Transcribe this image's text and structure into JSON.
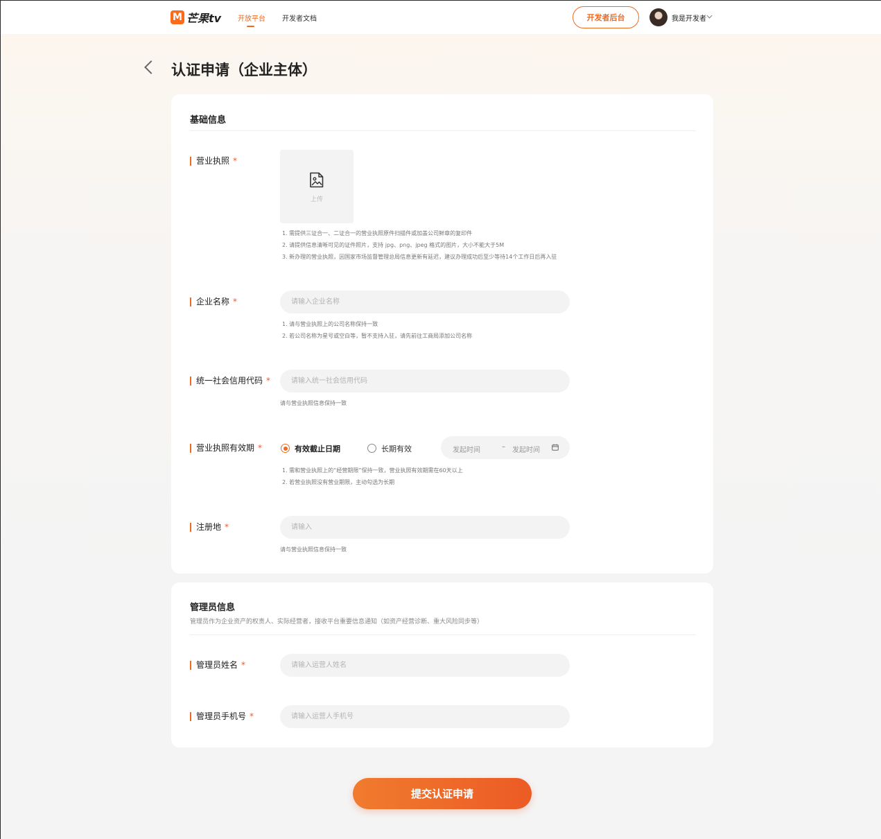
{
  "header": {
    "logo_mark": "M",
    "logo_text": "芒果tv",
    "nav": [
      {
        "label": "开放平台",
        "active": true
      },
      {
        "label": "开发者文档",
        "active": false
      }
    ],
    "dev_button": "开发者后台",
    "user_name": "我是开发者"
  },
  "page": {
    "title": "认证申请（企业主体）"
  },
  "basic": {
    "title": "基础信息",
    "license": {
      "label": "营业执照",
      "required": "*",
      "upload_label": "上传",
      "hints": [
        "1. 需提供三证合一、二证合一的营业执照原件扫描件或加盖公司鲜章的复印件",
        "2. 请提供信息清晰可见的证件照片，支持 jpg、png、jpeg 格式的图片，大小不能大于5M",
        "3. 新办理的营业执照，因国家市场监督管理总局信息更新有延迟，建议办理成功后至少等待14个工作日后再入驻"
      ]
    },
    "company_name": {
      "label": "企业名称",
      "required": "*",
      "placeholder": "请输入企业名称",
      "value": "",
      "hints": [
        "1. 请与营业执照上的公司名称保持一致",
        "2. 若公司名称为星号或空白等，暂不支持入驻，请先前往工商局添加公司名称"
      ]
    },
    "credit_code": {
      "label": "统一社会信用代码",
      "required": "*",
      "placeholder": "请输入统一社会信用代码",
      "value": "",
      "hint": "请与营业执照信息保持一致"
    },
    "validity": {
      "label": "营业执照有效期",
      "required": "*",
      "options": [
        {
          "label": "有效截止日期",
          "selected": true
        },
        {
          "label": "长期有效",
          "selected": false
        }
      ],
      "start_placeholder": "发起时间",
      "separator": "–",
      "end_placeholder": "发起时间",
      "hints": [
        "1. 需和营业执照上的“经营期限”保持一致，营业执照有效期需在60天以上",
        "2. 若营业执照没有营业期限，主动勾选为长期"
      ]
    },
    "registered_address": {
      "label": "注册地",
      "required": "*",
      "placeholder": "请输入",
      "value": "",
      "hint": "请与营业执照信息保持一致"
    }
  },
  "admin": {
    "title": "管理员信息",
    "subtitle": "管理员作为企业资产的权责人、实际经营者，接收平台重要信息通知（如资产经营诊断、重大风险同步等）",
    "name": {
      "label": "管理员姓名",
      "required": "*",
      "placeholder": "请输入运营人姓名",
      "value": ""
    },
    "phone": {
      "label": "管理员手机号",
      "required": "*",
      "placeholder": "请输入运营人手机号",
      "value": ""
    }
  },
  "submit_label": "提交认证申请",
  "colors": {
    "accent": "#ee6a1f",
    "required": "#ee5a2a"
  }
}
